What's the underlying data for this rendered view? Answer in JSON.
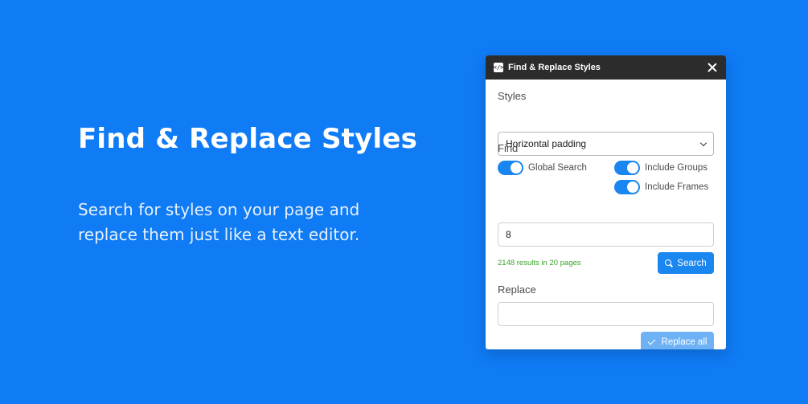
{
  "hero": {
    "title": "Find & Replace Styles",
    "subtitle": "Search for styles on your page and replace them just like a text editor."
  },
  "panel": {
    "title": "Find & Replace Styles",
    "plugin_icon": "code-icon",
    "styles_label": "Styles",
    "styles_selected": "Horizontal padding",
    "find_label": "Find",
    "toggles": {
      "global_search": {
        "label": "Global Search",
        "on": true
      },
      "include_groups": {
        "label": "Include Groups",
        "on": true
      },
      "include_frames": {
        "label": "Include Frames",
        "on": true
      }
    },
    "find_value": "8",
    "results_text": "2148 results in 20 pages",
    "search_label": "Search",
    "replace_label": "Replace",
    "replace_value": "",
    "replace_all_label": "Replace all"
  },
  "colors": {
    "background": "#0f7bf5",
    "accent": "#1a86f0",
    "titlebar": "#2c2c2c",
    "results": "#3aa32a",
    "replace_disabled": "#6eb2f5"
  }
}
